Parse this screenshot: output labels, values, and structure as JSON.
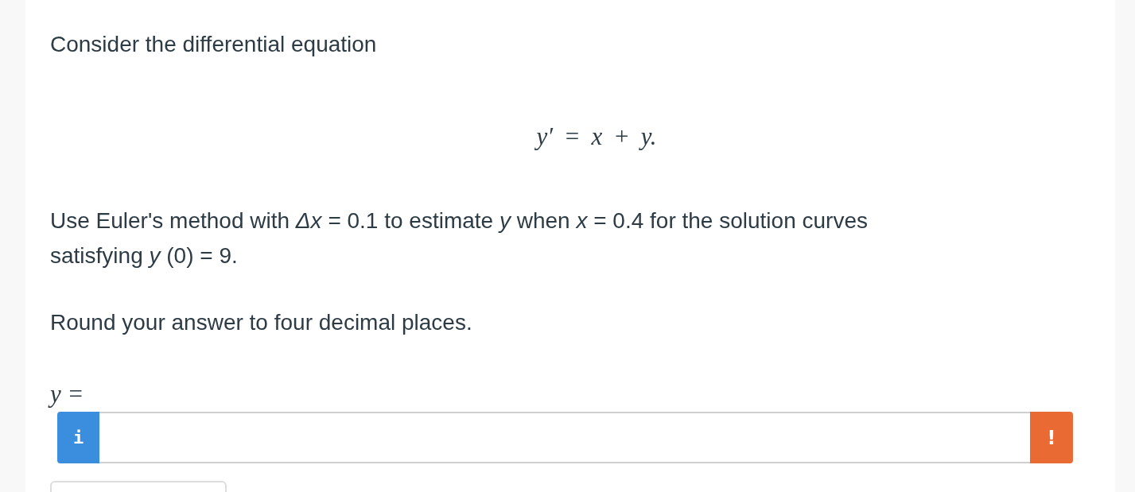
{
  "intro": "Consider the differential equation",
  "equation": "y′ = x + y.",
  "question": "Use Euler's method with *Δx* = 0.1 to estimate *y* when *x* = 0.4 for the solution curves satisfying *y* (0) = 9.",
  "instruction": "Round your answer to four decimal places.",
  "answer": {
    "label": "y =",
    "info_button": "i",
    "warning_button": "!"
  }
}
